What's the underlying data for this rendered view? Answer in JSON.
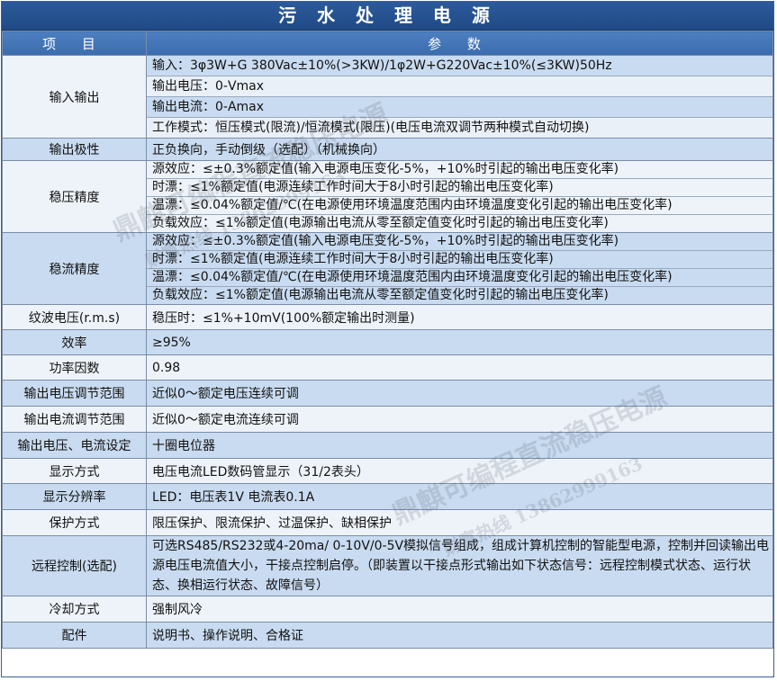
{
  "title": "污 水 处 理 电 源",
  "header": {
    "item": "项 目",
    "param": "参 数"
  },
  "rows": {
    "io": {
      "label": "输入输出",
      "lines": [
        "输入：3φ3W+G 380Vac±10%(>3KW)/1φ2W+G220Vac±10%(≤3KW)50Hz",
        "输出电压：0-Vmax",
        "输出电流：0-Amax",
        "工作模式：恒压模式(限流)/恒流模式(限压)(电压电流双调节两种模式自动切换)"
      ]
    },
    "polarity": {
      "label": "输出极性",
      "value": "正负换向，手动倒级（选配）（机械换向）"
    },
    "volt_precision": {
      "label": "稳压精度",
      "lines": [
        "源效应：≤±0.3%额定值(输入电源电压变化-5%，+10%时引起的输出电压变化率)",
        "时漂：≤1%额定值(电源连续工作时间大于8小时引起的输出电压变化率)",
        "温漂：≤0.04%额定值/℃(在电源使用环境温度范围内由环境温度变化引起的输出电压变化率)",
        "负载效应：≤1%额定值(电源输出电流从零至额定值变化时引起的输出电压变化率)"
      ]
    },
    "curr_precision": {
      "label": "稳流精度",
      "lines": [
        "源效应：≤±0.3%额定值(输入电源电压变化-5%，+10%时引起的输出电压变化率)",
        "时漂：≤1%额定值(电源连续工作时间大于8小时引起的输出电压变化率)",
        "温漂：≤0.04%额定值/℃(在电源使用环境温度范围内由环境温度变化引起的输出电压变化率)",
        "负载效应：≤1%额定值(电源输出电流从零至额定值变化时引起的输出电压变化率)"
      ]
    },
    "ripple": {
      "label": "纹波电压(r.m.s)",
      "value": "稳压时：≤1%+10mV(100%额定输出时测量)"
    },
    "efficiency": {
      "label": "效率",
      "value": "≥95%"
    },
    "power_factor": {
      "label": "功率因数",
      "value": "0.98"
    },
    "volt_range": {
      "label": "输出电压调节范围",
      "value": "近似0～额定电压连续可调"
    },
    "curr_range": {
      "label": "输出电流调节范围",
      "value": "近似0～额定电流连续可调"
    },
    "setting": {
      "label": "输出电压、电流设定",
      "value": "十圈电位器"
    },
    "display": {
      "label": "显示方式",
      "value": "电压电流LED数码管显示（31/2表头）"
    },
    "resolution": {
      "label": "显示分辨率",
      "value": "LED：电压表1V  电流表0.1A"
    },
    "protection": {
      "label": "保护方式",
      "value": "限压保护、限流保护、过温保护、缺相保护"
    },
    "remote": {
      "label": "远程控制(选配)",
      "value": "可选RS485/RS232或4-20ma/ 0-10V/0-5V模拟信号组成，组成计算机控制的智能型电源，控制并回读输出电源电压电流值大小，干接点控制启停。（即装置以干接点形式输出如下状态信号：远程控制模式状态、运行状态、换相运行状态、故障信号）"
    },
    "cooling": {
      "label": "冷却方式",
      "value": "强制风冷"
    },
    "accessories": {
      "label": "配件",
      "value": "说明书、操作说明、合格证"
    }
  },
  "watermarks": {
    "brand": "鼎麒可编程直流稳压电源",
    "hotline": "财富热线 13862999163"
  },
  "colors": {
    "title_bg": "#1f4a86",
    "header_bg": "#3a6cae",
    "row_blue": "#c9dbf0",
    "row_white": "#eef3f9"
  }
}
